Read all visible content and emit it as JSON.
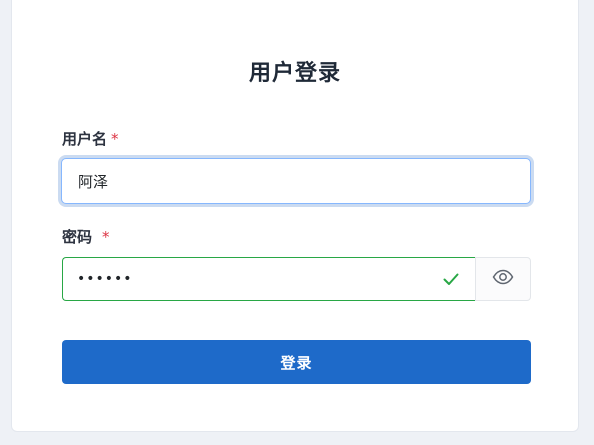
{
  "form": {
    "title": "用户登录",
    "username_label": "用户名",
    "username_required": "*",
    "username_value": "阿泽",
    "password_label": "密码",
    "password_required": "*",
    "password_masked": "••••••",
    "valid_icon": "check-icon",
    "toggle_icon": "eye-icon",
    "submit_label": "登录"
  },
  "colors": {
    "page_background": "#eef1f6",
    "primary_button": "#1e6ac9",
    "focus_border": "#86b7fe",
    "valid_border": "#28a745",
    "required_star": "#dc3545"
  }
}
